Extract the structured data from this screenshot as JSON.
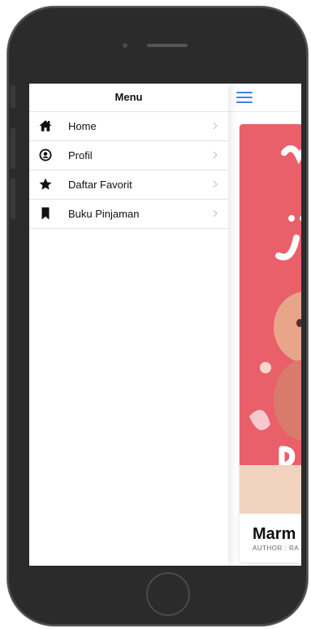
{
  "drawer": {
    "title": "Menu",
    "items": [
      {
        "label": "Home",
        "icon": "home-icon"
      },
      {
        "label": "Profil",
        "icon": "profile-icon"
      },
      {
        "label": "Daftar Favorit",
        "icon": "star-icon"
      },
      {
        "label": "Buku Pinjaman",
        "icon": "bookmark-icon"
      }
    ]
  },
  "book": {
    "title": "Marm",
    "author": "AUTHOR : RA"
  },
  "colors": {
    "accent": "#3b82f6",
    "cover": "#e9606a",
    "cover_floor": "#f2d3c0"
  }
}
